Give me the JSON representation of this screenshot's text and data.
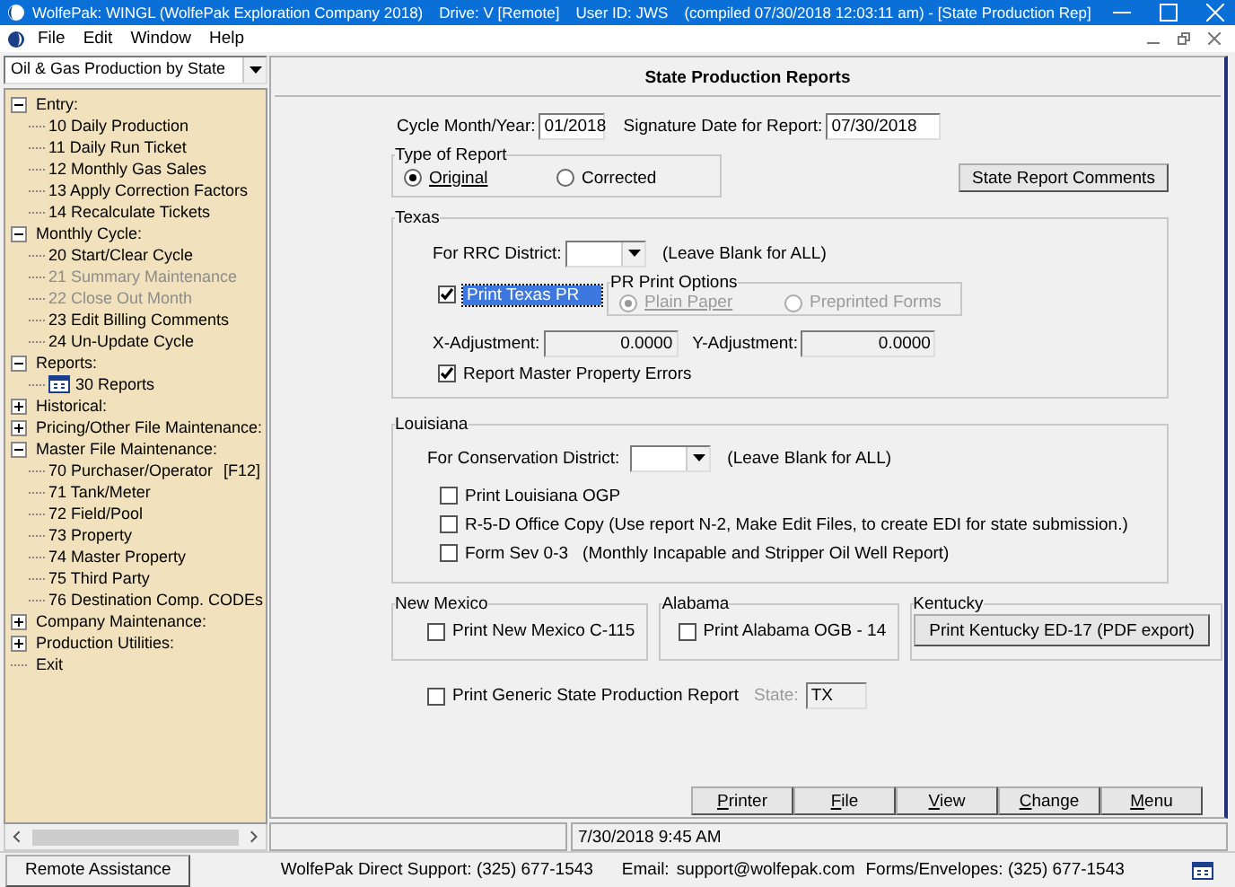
{
  "window": {
    "title_parts": [
      "WolfePak: WINGL (WolfePak Exploration Company 2018)",
      "Drive: V [Remote]",
      "User ID: JWS",
      "(compiled 07/30/2018 12:03:11 am) - [State Production Rep]"
    ]
  },
  "menu": [
    "File",
    "Edit",
    "Window",
    "Help"
  ],
  "sidebar": {
    "module": "Oil & Gas Production by State",
    "tree": [
      {
        "label": "Entry:",
        "expanded": true,
        "children": [
          {
            "label": "10 Daily Production",
            "disabled": false
          },
          {
            "label": "11 Daily Run Ticket",
            "disabled": false
          },
          {
            "label": "12 Monthly Gas Sales",
            "disabled": false
          },
          {
            "label": "13 Apply Correction Factors",
            "disabled": false
          },
          {
            "label": "14 Recalculate Tickets",
            "disabled": false
          }
        ]
      },
      {
        "label": "Monthly Cycle:",
        "expanded": true,
        "children": [
          {
            "label": "20 Start/Clear Cycle",
            "disabled": false
          },
          {
            "label": "21 Summary Maintenance",
            "disabled": true
          },
          {
            "label": "22 Close Out Month",
            "disabled": true
          },
          {
            "label": "23 Edit Billing Comments",
            "disabled": false
          },
          {
            "label": "24 Un-Update Cycle",
            "disabled": false
          }
        ]
      },
      {
        "label": "Reports:",
        "expanded": true,
        "children": [
          {
            "label": "30 Reports",
            "disabled": false,
            "kind": "report"
          }
        ]
      },
      {
        "label": "Historical:",
        "expanded": false
      },
      {
        "label": "Pricing/Other File Maintenance:",
        "expanded": false
      },
      {
        "label": "Master File Maintenance:",
        "expanded": true,
        "children": [
          {
            "label": "70 Purchaser/Operator",
            "shortcut": "[F12]",
            "disabled": false
          },
          {
            "label": "71 Tank/Meter",
            "disabled": false
          },
          {
            "label": "72 Field/Pool",
            "disabled": false
          },
          {
            "label": "73 Property",
            "disabled": false
          },
          {
            "label": "74 Master Property",
            "disabled": false
          },
          {
            "label": "75 Third Party",
            "disabled": false
          },
          {
            "label": "76 Destination Comp. CODEs",
            "disabled": false
          }
        ]
      },
      {
        "label": "Company Maintenance:",
        "expanded": false
      },
      {
        "label": "Production Utilities:",
        "expanded": false
      },
      {
        "label": "Exit",
        "kind": "leaf"
      }
    ]
  },
  "form": {
    "title": "State Production Reports",
    "cycle": {
      "label": "Cycle Month/Year:",
      "value": "01/2018"
    },
    "signature": {
      "label": "Signature Date for Report:",
      "value": "07/30/2018"
    },
    "report_type": {
      "legend": "Type of Report",
      "options": [
        {
          "label": "Original",
          "selected": true
        },
        {
          "label": "Corrected",
          "selected": false
        }
      ]
    },
    "comments_button": "State Report Comments",
    "texas": {
      "legend": "Texas",
      "district_label": "For RRC District:",
      "district_hint": "(Leave Blank for ALL)",
      "print_pr": {
        "label": "Print Texas PR",
        "checked": true,
        "focused": true
      },
      "pr_options": {
        "legend": "PR Print Options",
        "disabled": true,
        "options": [
          {
            "label": "Plain Paper",
            "selected": true
          },
          {
            "label": "Preprinted Forms",
            "selected": false
          }
        ]
      },
      "x_adjustment": {
        "label": "X-Adjustment:",
        "value": "0.0000",
        "read_only": true
      },
      "y_adjustment": {
        "label": "Y-Adjustment:",
        "value": "0.0000",
        "read_only": true
      },
      "master_errors": {
        "label": "Report Master Property Errors",
        "checked": true
      }
    },
    "louisiana": {
      "legend": "Louisiana",
      "district_label": "For Conservation District:",
      "district_hint": "(Leave Blank for ALL)",
      "checks": [
        {
          "label": "Print Louisiana OGP",
          "checked": false
        },
        {
          "label": "R-5-D Office Copy (Use report N-2, Make Edit Files, to create EDI for state submission.)",
          "checked": false
        },
        {
          "label": "Form Sev 0-3",
          "note": "(Monthly Incapable and Stripper Oil Well Report)",
          "checked": false
        }
      ]
    },
    "new_mexico": {
      "legend": "New Mexico",
      "check": {
        "label": "Print New Mexico C-115",
        "checked": false
      }
    },
    "alabama": {
      "legend": "Alabama",
      "check": {
        "label": "Print Alabama OGB - 14",
        "checked": false
      }
    },
    "kentucky": {
      "legend": "Kentucky",
      "button": "Print Kentucky ED-17 (PDF export)"
    },
    "generic": {
      "label": "Print Generic State Production Report",
      "checked": false,
      "state_label": "State:",
      "state_value": "TX",
      "state_disabled": true
    },
    "buttons": [
      "Printer",
      "File",
      "View",
      "Change",
      "Menu"
    ]
  },
  "status": {
    "datetime": "7/30/2018 9:45 AM"
  },
  "footer": {
    "remote_button": "Remote Assistance",
    "support": "WolfePak Direct Support: (325) 677-1543",
    "email_label": "Email:",
    "email": "support@wolfepak.com",
    "forms": "Forms/Envelopes: (325) 677-1543"
  }
}
